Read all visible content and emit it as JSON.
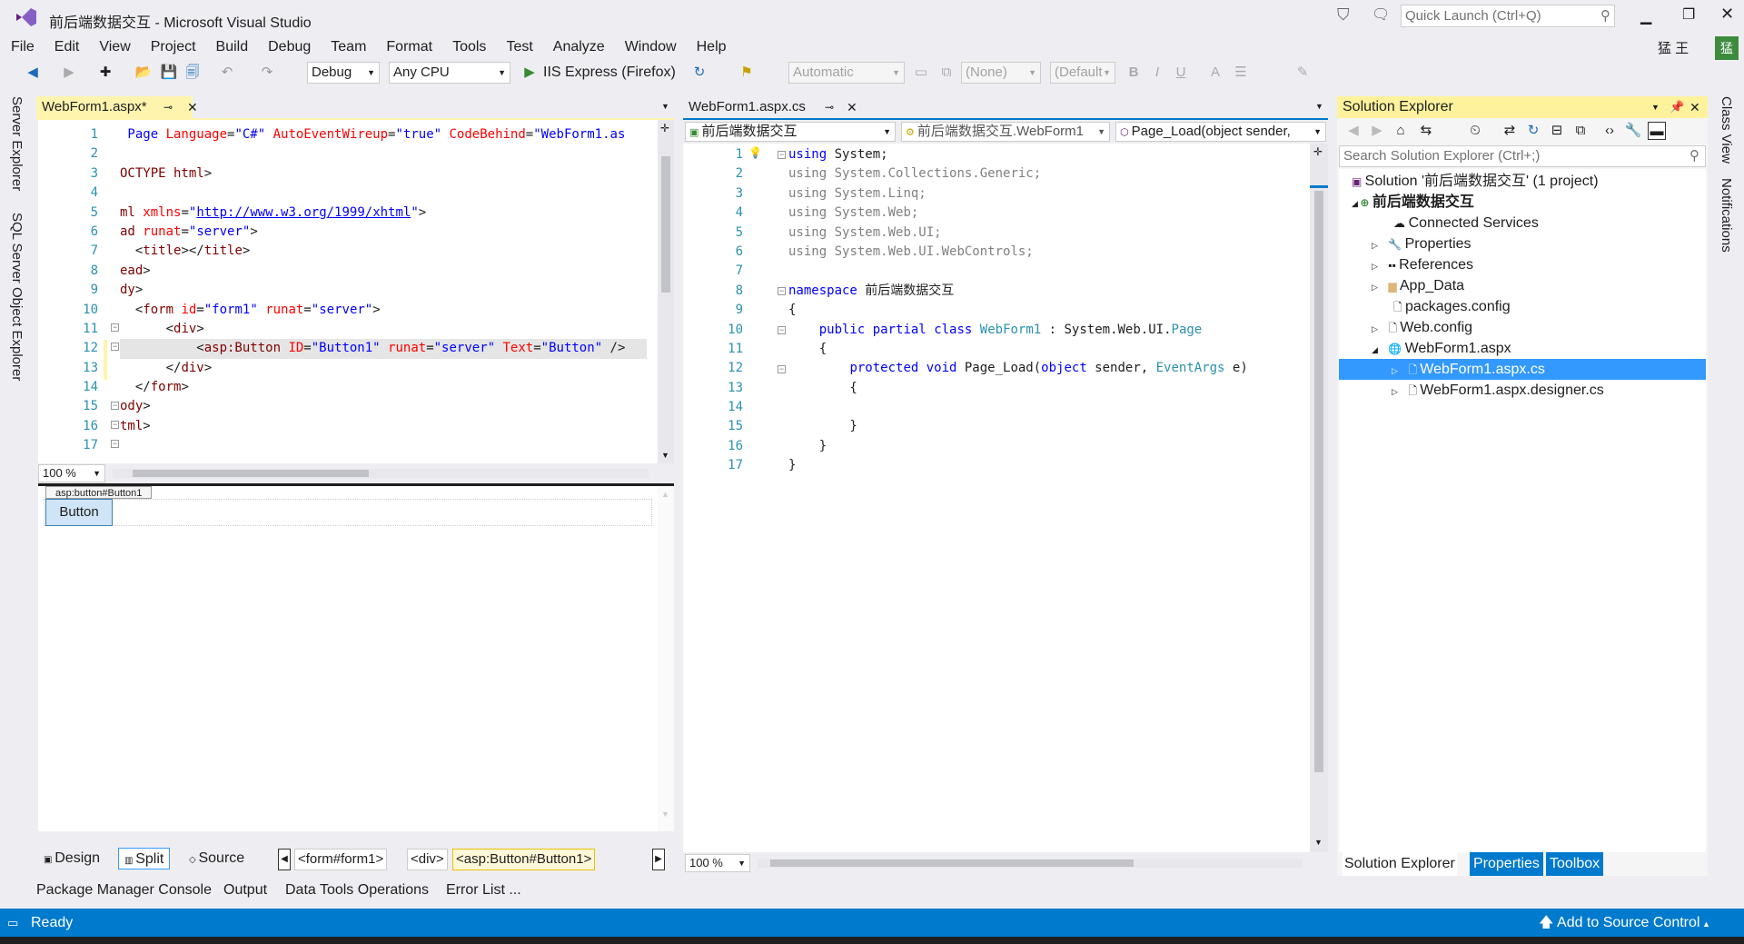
{
  "window": {
    "title": "前后端数据交互 - Microsoft Visual Studio",
    "quick_launch_placeholder": "Quick Launch (Ctrl+Q)",
    "user": "猛 王",
    "user_badge": "猛"
  },
  "menu": [
    "File",
    "Edit",
    "View",
    "Project",
    "Build",
    "Debug",
    "Team",
    "Format",
    "Tools",
    "Test",
    "Analyze",
    "Window",
    "Help"
  ],
  "toolbar": {
    "config": "Debug",
    "platform": "Any CPU",
    "run_label": "IIS Express (Firefox)",
    "auto": "Automatic",
    "none": "(None)",
    "default": "(Default"
  },
  "left_tabs": [
    "Server Explorer",
    "SQL Server Object Explorer"
  ],
  "right_tabs": [
    "Class View",
    "Notifications"
  ],
  "left_doc": {
    "tab": "WebForm1.aspx*",
    "lines": [
      "1",
      "2",
      "3",
      "4",
      "5",
      "6",
      "7",
      "8",
      "9",
      "10",
      "11",
      "12",
      "13",
      "14",
      "15",
      "16",
      "17"
    ],
    "zoom": "100 %",
    "design_tag_label": "asp:button#Button1",
    "design_button": "Button",
    "view_tabs": {
      "design": "Design",
      "split": "Split",
      "source": "Source"
    },
    "crumbs": [
      "<form#form1>",
      "<div>",
      "<asp:Button#Button1>"
    ]
  },
  "right_doc": {
    "tab": "WebForm1.aspx.cs",
    "nav_project": "前后端数据交互",
    "nav_class": "前后端数据交互.WebForm1",
    "nav_member": "Page_Load(object sender,",
    "lines": [
      "1",
      "2",
      "3",
      "4",
      "5",
      "6",
      "7",
      "8",
      "9",
      "10",
      "11",
      "12",
      "13",
      "14",
      "15",
      "16",
      "17"
    ],
    "zoom": "100 %"
  },
  "solution": {
    "header": "Solution Explorer",
    "search_placeholder": "Search Solution Explorer (Ctrl+;)",
    "items": [
      "Solution '前后端数据交互' (1 project)",
      "前后端数据交互",
      "Connected Services",
      "Properties",
      "References",
      "App_Data",
      "packages.config",
      "Web.config",
      "WebForm1.aspx",
      "WebForm1.aspx.cs",
      "WebForm1.aspx.designer.cs"
    ],
    "bottom_tabs": [
      "Solution Explorer",
      "Properties",
      "Toolbox"
    ]
  },
  "bottom_tabs": [
    "Package Manager Console",
    "Output",
    "Data Tools Operations",
    "Error List ..."
  ],
  "status": {
    "text": "Ready",
    "source_control": "Add to Source Control"
  },
  "colors": {
    "accent": "#007acc",
    "selection": "#3399ff",
    "keyword": "#0000ff",
    "type": "#2b91af"
  }
}
